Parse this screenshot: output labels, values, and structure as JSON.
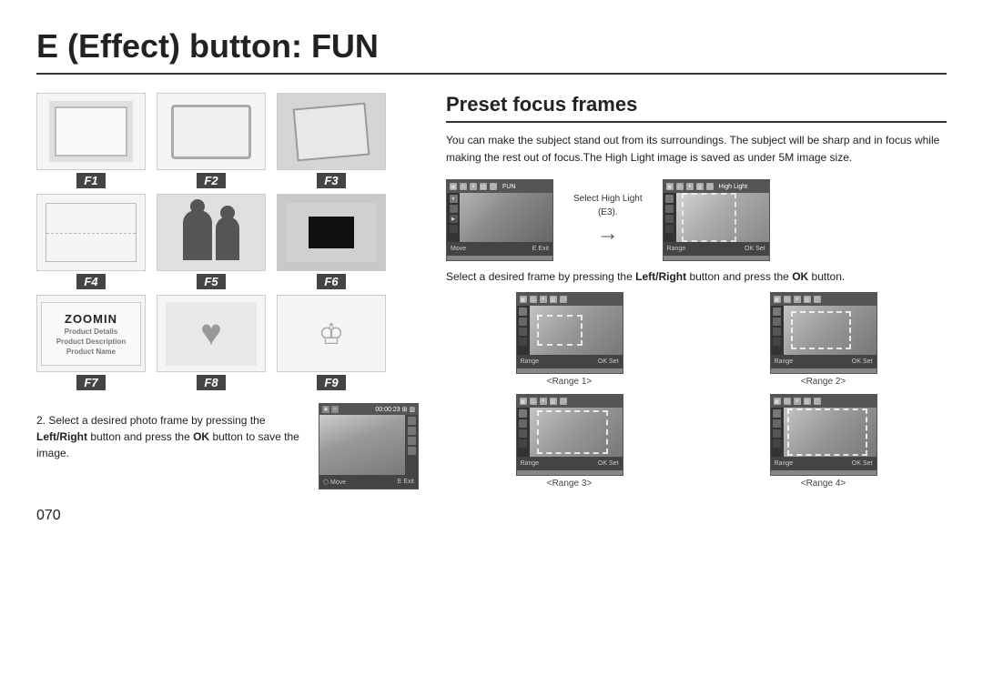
{
  "page": {
    "title": "E (Effect) button: FUN",
    "page_number": "070"
  },
  "frames": [
    {
      "id": "f1",
      "label": "F1"
    },
    {
      "id": "f2",
      "label": "F2"
    },
    {
      "id": "f3",
      "label": "F3"
    },
    {
      "id": "f4",
      "label": "F4"
    },
    {
      "id": "f5",
      "label": "F5"
    },
    {
      "id": "f6",
      "label": "F6"
    },
    {
      "id": "f7",
      "label": "F7",
      "text": "ZOOMIN",
      "sub1": "Product Details",
      "sub2": "Product Description",
      "sub3": "Product Name"
    },
    {
      "id": "f8",
      "label": "F8"
    },
    {
      "id": "f9",
      "label": "F9"
    }
  ],
  "step2": {
    "number": "2.",
    "text": "Select a desired photo frame by pressing the ",
    "bold1": "Left/Right",
    "text2": " button and press the ",
    "bold2": "OK",
    "text3": " button to save the image."
  },
  "preset": {
    "title": "Preset focus frames",
    "description": "You can make the subject stand out from its surroundings. The subject will be sharp and in focus while making the rest out of focus.The High Light image is saved as under 5M image size.",
    "camera1_label": "FUN",
    "camera2_label": "High Light",
    "select_high_light": "Select High Light",
    "select_high_light_sub": "(E3).",
    "select_text": "Select a desired frame by pressing the ",
    "select_bold1": "Left/Right",
    "select_text2": " button and press the ",
    "select_bold2": "OK",
    "select_text3": " button.",
    "ranges": [
      {
        "label": "<Range 1>"
      },
      {
        "label": "<Range 2>"
      },
      {
        "label": "<Range 3>"
      },
      {
        "label": "<Range 4>"
      }
    ],
    "cam_bottom_move": "Move",
    "cam_bottom_exit": "E Exit",
    "cam_bottom_range": "Range",
    "cam_bottom_ok": "OK Set"
  }
}
